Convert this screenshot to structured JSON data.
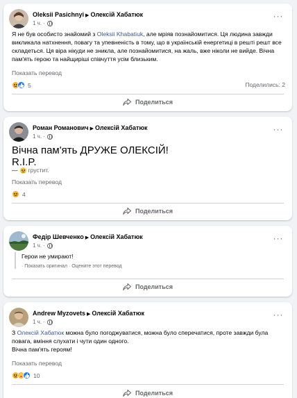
{
  "posts": [
    {
      "author": "Oleksii Pasichnyi",
      "target": "Олексій Хабатюк",
      "time": "1 ч.",
      "text_before": "Я не був особисто знайомий з ",
      "mention": "Oleksii Khabatiuk",
      "text_after": ", але мріяв познайомитися. Ця людина завжди викликала натхнення, повагу та упевненість в тому, що в українській енергетиці в решті решт все складеться. Ця віра нікуди не зникла, але познайомитися, на жаль, вже ніколи не вийде. Вічна пам'ять герою та найщиріші співчуття усім близьким.",
      "see_translation": "Показать перевод",
      "reactions_count": "5",
      "shares": "Поделились: 2",
      "share_label": "Поделиться"
    },
    {
      "author": "Роман Романович",
      "target": "Олексій Хабатюк",
      "time": "1 ч.",
      "big_line1": "Вічна пам'ять ДРУЖЕ ОЛЕКСІЙ!",
      "big_line2": "R.I.P.",
      "feeling_dash": "—",
      "feeling": "грустит.",
      "see_translation": "Показать перевод",
      "reactions_count": "4",
      "share_label": "Поделиться"
    },
    {
      "author": "Федір Шевченко",
      "target": "Олексій Хабатюк",
      "time": "1 ч.",
      "quote": "Герои не умирают!",
      "show_original": "· Показать оригинал",
      "rate_translation": "· Оцените этот перевод",
      "share_label": "Поделиться"
    },
    {
      "author": "Andrew Myzovets",
      "target": "Олексій Хабатюк",
      "time": "1 ч.",
      "text_before": "З ",
      "mention": "Олексій Хабатюк",
      "text_after": " можна було погоджуватися, можна було сперечатися, проте завжди була повага, вміння слухати і чути один одного.",
      "text_line2": "Вічна пам'ять героям!",
      "see_translation": "Показать перевод",
      "reactions_count": "10",
      "share_label": "Поделиться"
    }
  ],
  "icons": {
    "more": "more-options-icon",
    "share": "share-arrow-icon",
    "globe": "globe-icon",
    "like": "like-reaction-icon",
    "sad": "sad-reaction-icon",
    "care": "care-reaction-icon"
  },
  "colors": {
    "background": "#f0f2f5",
    "link": "#385898",
    "secondary_text": "#65676b",
    "like_blue": "#1877f2",
    "reaction_yellow": "#f7b125"
  }
}
